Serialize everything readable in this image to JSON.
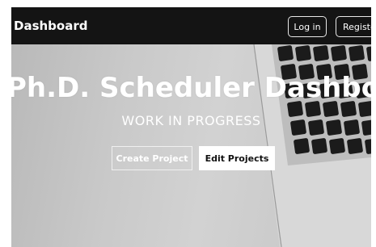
{
  "navbar": {
    "brand": "Dashboard",
    "login_label": "Log in",
    "register_label": "Register"
  },
  "hero": {
    "title": "Ph.D. Scheduler Dashboard",
    "subtitle": "WORK IN PROGRESS",
    "create_label": "Create Project",
    "edit_label": "Edit Projects"
  }
}
